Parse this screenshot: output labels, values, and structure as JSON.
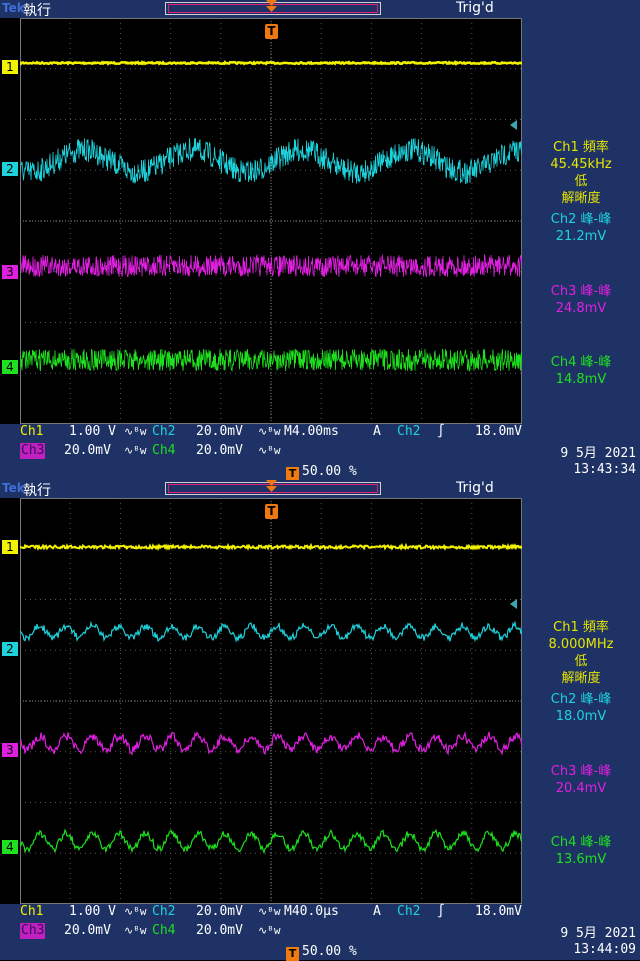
{
  "colors": {
    "ch1": "#f2f200",
    "ch2": "#1ed2dc",
    "ch3": "#e020e0",
    "ch4": "#1ee01e",
    "bar": "#1f3266",
    "trigger": "#f07a10"
  },
  "panels": [
    {
      "brand": "Tek",
      "run_state": "執行",
      "trig_status": "Trig'd",
      "trigger_marker": "T",
      "channel_markers": [
        "1",
        "2",
        "3",
        "4"
      ],
      "measurements": {
        "ch1_title": "Ch1 頻率",
        "ch1_value": "45.45kHz",
        "ch1_note_1": "低",
        "ch1_note_2": "解晰度",
        "ch2_title": "Ch2 峰-峰",
        "ch2_value": "21.2mV",
        "ch3_title": "Ch3 峰-峰",
        "ch3_value": "24.8mV",
        "ch4_title": "Ch4 峰-峰",
        "ch4_value": "14.8mV"
      },
      "bottom": {
        "ch1_label": "Ch1",
        "ch1_scale": "1.00 V",
        "ch2_label": "Ch2",
        "ch2_scale": "20.0mV",
        "ch3_label": "Ch3",
        "ch3_scale": "20.0mV",
        "ch4_label": "Ch4",
        "ch4_scale": "20.0mV",
        "coupling_symbol": "∿ᴮw",
        "timebase": "M4.00ms",
        "trig_mode": "A",
        "trig_source": "Ch2",
        "trig_slope": "∫",
        "trig_level": "18.0mV",
        "trig_position_marker": "T",
        "trig_position": "50.00 %",
        "date": "9 5月  2021",
        "time": "13:43:34"
      },
      "traces": {
        "ch2_shape": "sine-4-cycles",
        "ch3_shape": "noise",
        "ch4_shape": "noise"
      }
    },
    {
      "brand": "Tek",
      "run_state": "執行",
      "trig_status": "Trig'd",
      "trigger_marker": "T",
      "channel_markers": [
        "1",
        "2",
        "3",
        "4"
      ],
      "measurements": {
        "ch1_title": "Ch1 頻率",
        "ch1_value": "8.000MHz",
        "ch1_note_1": "低",
        "ch1_note_2": "解晰度",
        "ch2_title": "Ch2 峰-峰",
        "ch2_value": "18.0mV",
        "ch3_title": "Ch3 峰-峰",
        "ch3_value": "20.4mV",
        "ch4_title": "Ch4 峰-峰",
        "ch4_value": "13.6mV"
      },
      "bottom": {
        "ch1_label": "Ch1",
        "ch1_scale": "1.00 V",
        "ch2_label": "Ch2",
        "ch2_scale": "20.0mV",
        "ch3_label": "Ch3",
        "ch3_scale": "20.0mV",
        "ch4_label": "Ch4",
        "ch4_scale": "20.0mV",
        "coupling_symbol": "∿ᴮw",
        "timebase": "M40.0µs",
        "trig_mode": "A",
        "trig_source": "Ch2",
        "trig_slope": "∫",
        "trig_level": "18.0mV",
        "trig_position_marker": "T",
        "trig_position": "50.00 %",
        "date": "9 5月  2021",
        "time": "13:44:09"
      },
      "traces": {
        "ch2_shape": "ripple",
        "ch3_shape": "ripple",
        "ch4_shape": "ripple"
      }
    }
  ]
}
